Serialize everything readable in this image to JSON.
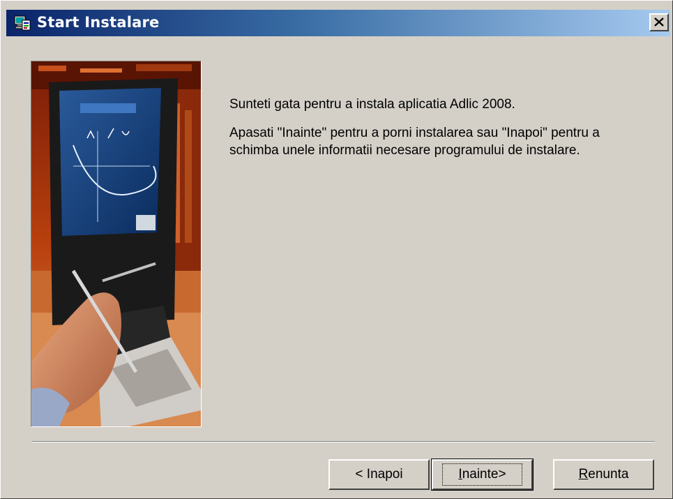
{
  "window": {
    "title": "Start Instalare",
    "close_label": "×"
  },
  "content": {
    "line1": "Sunteti gata pentru a instala aplicatia Adlic 2008.",
    "line2": "Apasati \"Inainte\" pentru a porni instalarea sau \"Inapoi\" pentru a schimba unele informatii necesare programului de instalare."
  },
  "buttons": {
    "back": "< Inapoi",
    "next_underlined": "I",
    "next_rest": "nainte>",
    "cancel_underlined": "R",
    "cancel_rest": "enunta"
  },
  "colors": {
    "dialog_bg": "#d4d0c8",
    "title_start": "#0a246a",
    "title_end": "#a6caf0"
  },
  "icons": {
    "app": "installer-computer-icon",
    "close": "close-icon"
  }
}
